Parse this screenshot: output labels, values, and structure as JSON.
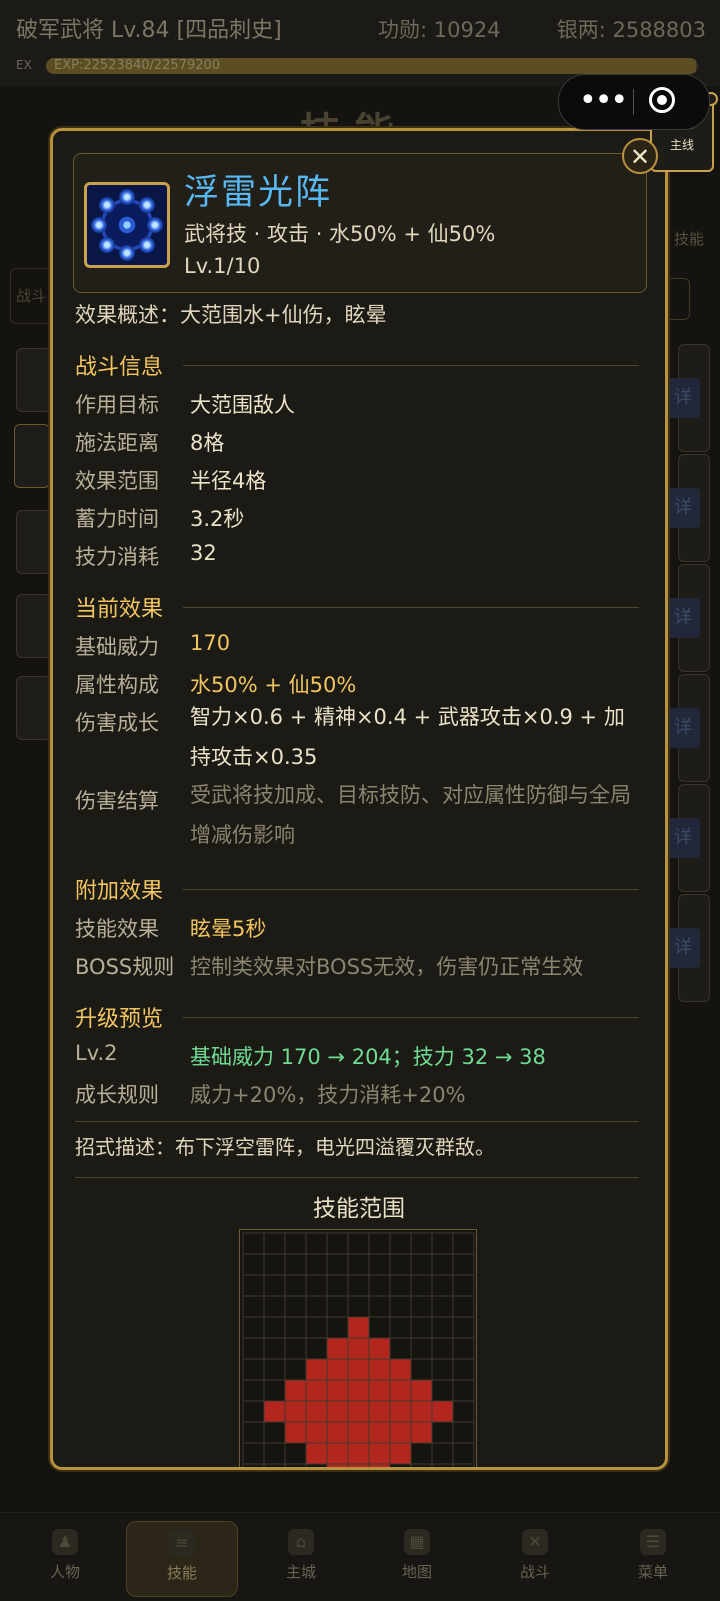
{
  "topbar": {
    "title": "破军武将 Lv.84 [四品刺史]",
    "merit": "功勋: 10924",
    "silver": "银两: 2588803",
    "exp_label": "EX",
    "exp_text": "EXP:22523840/22579200",
    "exp_fraction": 0.9975
  },
  "background": {
    "page_title": "技能",
    "left_tab": "战斗",
    "right_tab": "技能",
    "detail_glyph": "详"
  },
  "capsule": {
    "menu_icon": "more-dots-icon",
    "close_icon": "target-icon"
  },
  "mainline_badge": {
    "glyph": "主",
    "label": "主线"
  },
  "modal": {
    "close_icon": "close-icon",
    "skill": {
      "name": "浮雷光阵",
      "meta": "武将技 · 攻击 · 水50% + 仙50%",
      "level": "Lv.1/10",
      "icon": "thunder-array-icon"
    },
    "summary": "效果概述：大范围水+仙伤，眩晕",
    "sections": {
      "battle": {
        "title": "战斗信息",
        "rows": [
          {
            "label": "作用目标",
            "value": "大范围敌人"
          },
          {
            "label": "施法距离",
            "value": "8格"
          },
          {
            "label": "效果范围",
            "value": "半径4格"
          },
          {
            "label": "蓄力时间",
            "value": "3.2秒"
          },
          {
            "label": "技力消耗",
            "value": "32"
          }
        ]
      },
      "current": {
        "title": "当前效果",
        "rows": [
          {
            "label": "基础威力",
            "value": "170"
          },
          {
            "label": "属性构成",
            "value": "水50% + 仙50%"
          },
          {
            "label": "伤害成长",
            "value": "智力×0.6 + 精神×0.4 + 武器攻击×0.9 + 加持攻击×0.35"
          },
          {
            "label": "伤害结算",
            "value": "受武将技加成、目标技防、对应属性防御与全局增减伤影响"
          }
        ]
      },
      "extra": {
        "title": "附加效果",
        "rows": [
          {
            "label": "技能效果",
            "value": "眩晕5秒"
          },
          {
            "label": "BOSS规则",
            "value": "控制类效果对BOSS无效，伤害仍正常生效"
          }
        ]
      },
      "upgrade": {
        "title": "升级预览",
        "rows": [
          {
            "label": "Lv.2",
            "value": "基础威力 170 → 204；技力 32 → 38"
          },
          {
            "label": "成长规则",
            "value": "威力+20%，技力消耗+20%"
          }
        ]
      }
    },
    "description": "招式描述：布下浮空雷阵，电光四溢覆灭群敌。",
    "range": {
      "title": "技能范围",
      "colors": {
        "area": "#b3261e",
        "caster": "#f4d03f",
        "grid": "#3d3a30"
      },
      "half_widths_by_row": [
        null,
        null,
        null,
        null,
        0,
        1,
        2,
        3,
        4,
        3,
        2,
        1,
        0,
        null
      ],
      "area_center_column": 5,
      "caster_column": 5,
      "caster_row": 13
    }
  },
  "bottom_nav": [
    {
      "label": "人物",
      "icon": "character-icon"
    },
    {
      "label": "技能",
      "icon": "scroll-icon",
      "active": true
    },
    {
      "label": "主城",
      "icon": "castle-icon"
    },
    {
      "label": "地图",
      "icon": "map-icon"
    },
    {
      "label": "战斗",
      "icon": "crossed-swords-icon"
    },
    {
      "label": "菜单",
      "icon": "menu-icon"
    }
  ]
}
